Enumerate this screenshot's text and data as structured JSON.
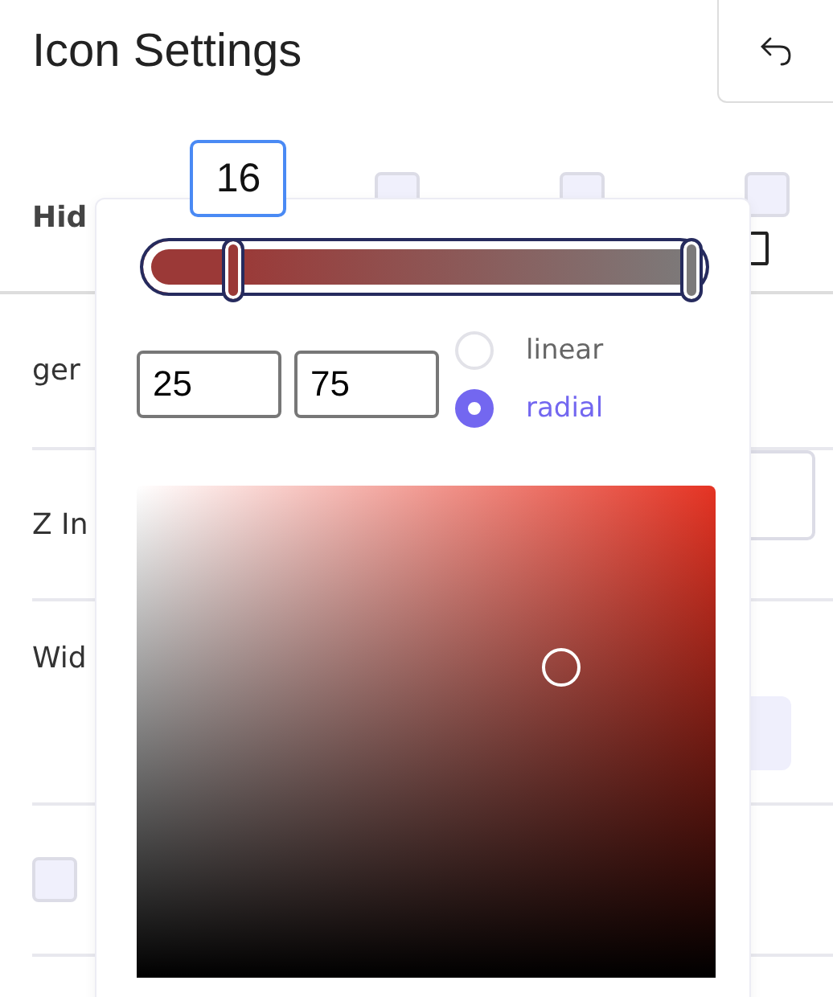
{
  "header": {
    "title": "Icon Settings"
  },
  "rows": [
    {
      "kind": "checks",
      "label": "Hid",
      "checks": [
        {
          "checked": false
        },
        {
          "checked": false
        },
        {
          "checked": false
        }
      ]
    },
    {
      "kind": "text",
      "label": "ger"
    },
    {
      "kind": "select",
      "label": "Z In"
    },
    {
      "kind": "button",
      "label": "Wid"
    },
    {
      "kind": "checkbox",
      "checked": false
    }
  ],
  "gradient_picker": {
    "tooltip": "16",
    "stops": [
      {
        "level": 0.16,
        "color": "#9b3937"
      },
      {
        "level": 0.975,
        "color": "#7c7a7a"
      }
    ],
    "inputs": [
      {
        "value": "25"
      },
      {
        "value": "75"
      }
    ],
    "types": [
      {
        "label": "linear",
        "selected": false
      },
      {
        "label": "radial",
        "selected": true
      }
    ]
  }
}
